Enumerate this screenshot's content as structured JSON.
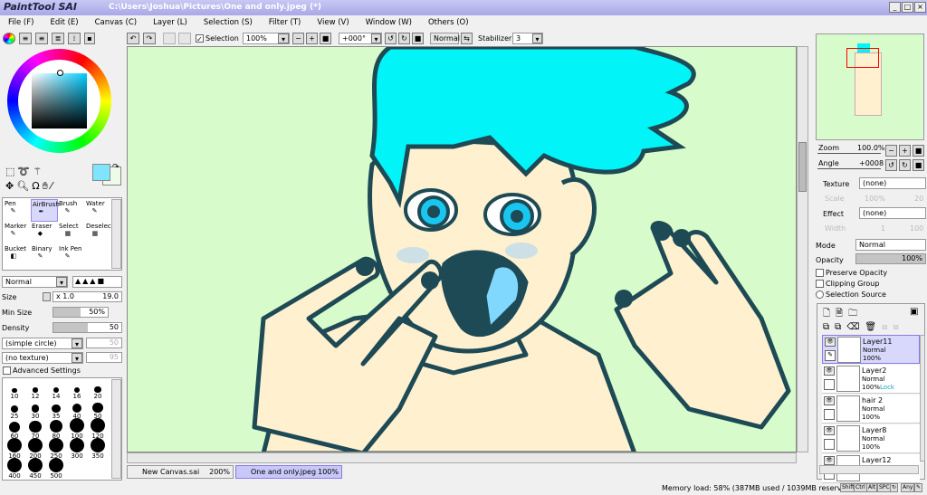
{
  "app": {
    "logo": "PaintTool SAI",
    "title": "C:\\Users\\Joshua\\Pictures\\One and only.jpeg (*)"
  },
  "menu": [
    "File (F)",
    "Edit (E)",
    "Canvas (C)",
    "Layer (L)",
    "Selection (S)",
    "Filter (T)",
    "View (V)",
    "Window (W)",
    "Others (O)"
  ],
  "toolbar": {
    "selection_label": "Selection",
    "selection_checked": true,
    "zoom": "100%",
    "angle": "+000°",
    "mode": "Normal",
    "stabilizer_label": "Stabilizer",
    "stabilizer": "3"
  },
  "colors": {
    "primary": "#80e4ff",
    "secondary": "#eefbe8",
    "canvas_bg": "#d8fbcc",
    "hair": "#00f4f8",
    "skin": "#fff0d0",
    "outline": "#1d4a55",
    "accent": "#d8d8fc"
  },
  "tools": [
    {
      "label": "Pen"
    },
    {
      "label": "AirBrush"
    },
    {
      "label": "Brush"
    },
    {
      "label": "Water"
    },
    {
      "label": "Marker"
    },
    {
      "label": "Eraser"
    },
    {
      "label": "Select"
    },
    {
      "label": "Deselect"
    },
    {
      "label": "Bucket"
    },
    {
      "label": "Binary"
    },
    {
      "label": "Ink Pen"
    }
  ],
  "brush": {
    "blend_mode": "Normal",
    "size_label": "Size",
    "size_mult": "x 1.0",
    "size": "19.0",
    "min_size_label": "Min Size",
    "min_size": "50%",
    "min_size_value": 50,
    "density_label": "Density",
    "density": "50",
    "density_value": 50,
    "shape": "(simple circle)",
    "shape_value": "50",
    "texture": "(no texture)",
    "texture_value": "95",
    "advanced_label": "Advanced Settings"
  },
  "brush_sizes": [
    "10",
    "12",
    "14",
    "16",
    "20",
    "25",
    "30",
    "35",
    "40",
    "50",
    "60",
    "70",
    "80",
    "100",
    "120",
    "160",
    "200",
    "250",
    "300",
    "350",
    "400",
    "450",
    "500"
  ],
  "tabs": [
    {
      "name": "New Canvas.sai",
      "zoom": "200%"
    },
    {
      "name": "One and only.jpeg",
      "zoom": "100%",
      "active": true
    }
  ],
  "navigator": {
    "zoom_label": "Zoom",
    "zoom": "100.0%",
    "angle_label": "Angle",
    "angle": "+0008"
  },
  "layer_panel": {
    "texture_label": "Texture",
    "texture": "(none)",
    "scale_label": "Scale",
    "scale": "100%",
    "scale_val": "20",
    "effect_label": "Effect",
    "effect": "(none)",
    "width_label": "Width",
    "width": "1",
    "width_val": "100",
    "mode_label": "Mode",
    "mode": "Normal",
    "opacity_label": "Opacity",
    "opacity": "100%",
    "preserve_opacity": "Preserve Opacity",
    "clipping_group": "Clipping Group",
    "selection_source": "Selection Source"
  },
  "layers": [
    {
      "name": "Layer11",
      "mode": "Normal",
      "opacity": "100%"
    },
    {
      "name": "Layer2",
      "mode": "Normal",
      "opacity": "100%",
      "lock": "Lock"
    },
    {
      "name": "hair 2",
      "mode": "Normal",
      "opacity": "100%"
    },
    {
      "name": "Layer8",
      "mode": "Normal",
      "opacity": "100%"
    },
    {
      "name": "Layer12"
    }
  ],
  "status": {
    "memory": "Memory load: 58% (387MB used / 1039MB reserved)",
    "keys": [
      "Shift",
      "Ctrl",
      "Alt",
      "SPC",
      "↻",
      "Any",
      "✎"
    ]
  }
}
